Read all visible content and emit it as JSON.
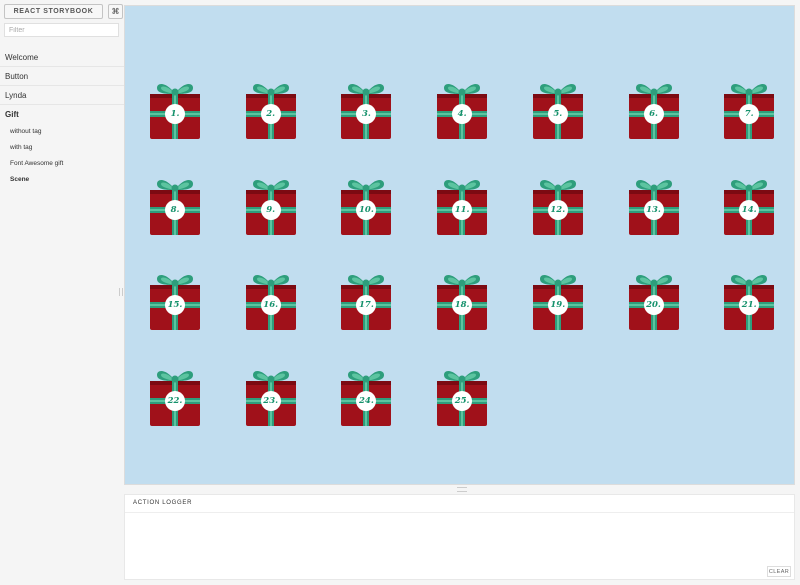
{
  "sidebar": {
    "brand": "REACT STORYBOOK",
    "shortcut_icon": "keyboard-shortcut-icon",
    "shortcut_glyph": "⌘",
    "filter_placeholder": "Filter",
    "kinds": [
      {
        "label": "Welcome"
      },
      {
        "label": "Button"
      },
      {
        "label": "Lynda"
      },
      {
        "label": "Gift",
        "active": true
      }
    ],
    "stories": [
      {
        "label": "without tag",
        "selected": false
      },
      {
        "label": "with tag",
        "selected": false
      },
      {
        "label": "Font Awesome gift",
        "selected": false
      },
      {
        "label": "Scene",
        "selected": true
      }
    ]
  },
  "preview": {
    "background": "#c1ddef",
    "gift_colors": {
      "box": "#a0111a",
      "box_dark": "#7c0a12",
      "ribbon": "#2e9e7c",
      "ribbon_light": "#5cc4a0",
      "tag": "#ffffff",
      "number": "#14916b"
    },
    "gifts": [
      "1.",
      "2.",
      "3.",
      "4.",
      "5.",
      "6.",
      "7.",
      "8.",
      "9.",
      "10.",
      "11.",
      "12.",
      "13.",
      "14.",
      "15.",
      "16.",
      "17.",
      "18.",
      "19.",
      "20.",
      "21.",
      "22.",
      "23.",
      "24.",
      "25."
    ]
  },
  "logger": {
    "title": "ACTION LOGGER",
    "clear_label": "CLEAR"
  }
}
